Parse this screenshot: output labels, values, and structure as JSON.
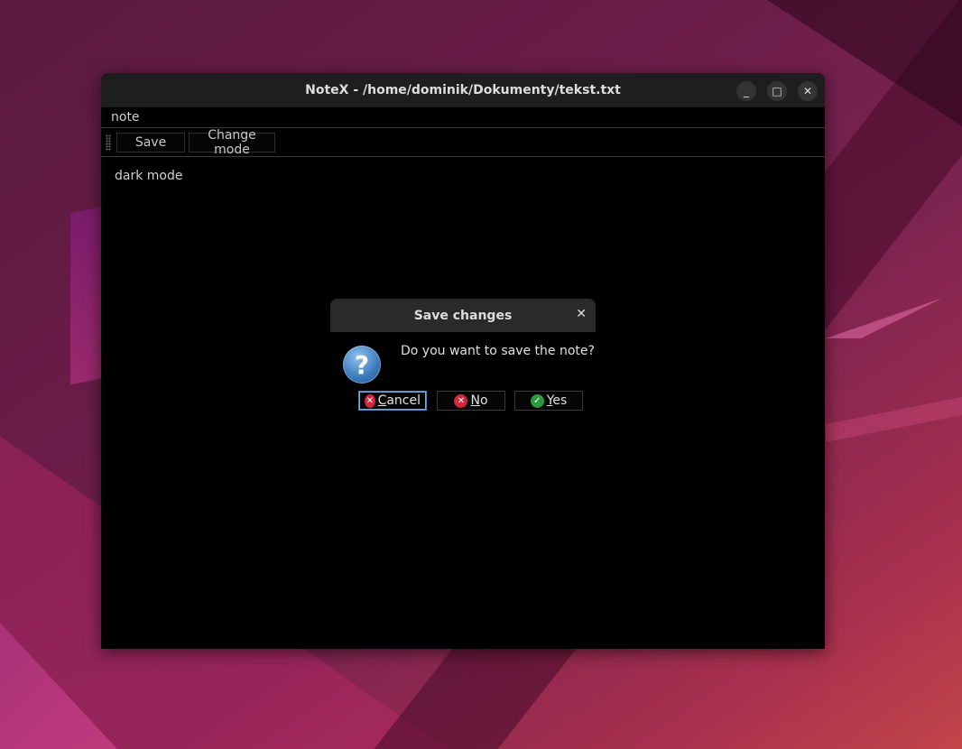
{
  "window": {
    "title": "NoteX - /home/dominik/Dokumenty/tekst.txt",
    "controls": [
      "minimize-icon",
      "maximize-icon",
      "close-icon"
    ]
  },
  "menubar": {
    "items": [
      "note"
    ]
  },
  "toolbar": {
    "save_label": "Save",
    "change_mode_label": "Change mode"
  },
  "editor": {
    "content": "dark mode"
  },
  "dialog": {
    "title": "Save changes",
    "message": "Do you want to save the note?",
    "icon": "question-icon",
    "buttons": [
      {
        "label_first": "C",
        "label_rest": "ancel",
        "icon": "cancel-icon",
        "focused": true
      },
      {
        "label_first": "N",
        "label_rest": "o",
        "icon": "no-icon"
      },
      {
        "label_first": "Y",
        "label_rest": "es",
        "icon": "yes-icon"
      }
    ]
  },
  "colors": {
    "window_bg": "#000000",
    "titlebar": "#1e1e1e",
    "focus_ring": "#4a86c8",
    "cancel_red": "#d0273b",
    "yes_green": "#2b9a3e"
  }
}
